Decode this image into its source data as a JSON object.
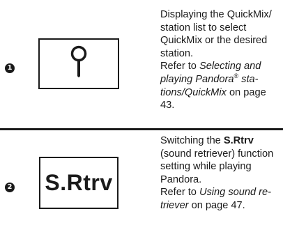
{
  "items": [
    {
      "number": "1",
      "icon": "search-icon",
      "desc_lines": [
        "Displaying the QuickMix/",
        "station list to select",
        "QuickMix or the desired",
        "station."
      ],
      "ref_prefix": "Refer to ",
      "ref_italic_1": "Selecting and",
      "ref_italic_2": "playing Pandora",
      "ref_reg": "®",
      "ref_italic_3": " sta-",
      "ref_italic_4": "tions/QuickMix",
      "ref_suffix": " on page",
      "ref_page": "43."
    },
    {
      "number": "2",
      "button_label": "S.Rtrv",
      "desc_prefix": "Switching the ",
      "desc_bold": "S.Rtrv",
      "desc_lines": [
        "(sound retriever) function",
        "setting while playing",
        "Pandora."
      ],
      "ref_prefix": "Refer to ",
      "ref_italic_1": "Using sound re-",
      "ref_italic_2": "triever",
      "ref_suffix": " on page 47."
    }
  ]
}
